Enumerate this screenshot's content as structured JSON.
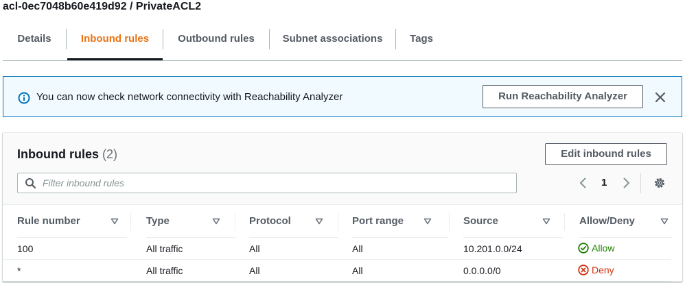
{
  "page_title": "acl-0ec7048b60e419d92 / PrivateACL2",
  "tabs": [
    {
      "label": "Details",
      "active": false
    },
    {
      "label": "Inbound rules",
      "active": true
    },
    {
      "label": "Outbound rules",
      "active": false
    },
    {
      "label": "Subnet associations",
      "active": false
    },
    {
      "label": "Tags",
      "active": false
    }
  ],
  "banner": {
    "icon": "info-icon",
    "message": "You can now check network connectivity with Reachability Analyzer",
    "button_label": "Run Reachability Analyzer",
    "close_icon": "close-icon"
  },
  "panel": {
    "title": "Inbound rules",
    "count": "(2)",
    "edit_button": "Edit inbound rules",
    "filter_placeholder": "Filter inbound rules",
    "filter_value": "",
    "page_number": "1"
  },
  "table": {
    "columns": [
      "Rule number",
      "Type",
      "Protocol",
      "Port range",
      "Source",
      "Allow/Deny"
    ],
    "rows": [
      {
        "rule_number": "100",
        "type": "All traffic",
        "protocol": "All",
        "port_range": "All",
        "source": "10.201.0.0/24",
        "action": "Allow",
        "action_icon": "check-circle-icon"
      },
      {
        "rule_number": "*",
        "type": "All traffic",
        "protocol": "All",
        "port_range": "All",
        "source": "0.0.0.0/0",
        "action": "Deny",
        "action_icon": "x-circle-icon"
      }
    ]
  },
  "colors": {
    "accent": "#ec7211",
    "info": "#0073bb",
    "allow": "#1d8102",
    "deny": "#d13212"
  }
}
